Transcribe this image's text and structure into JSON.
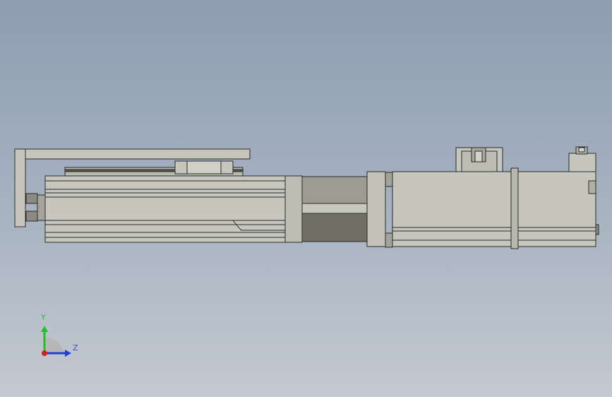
{
  "viewport": {
    "background_top": "#8e9db1",
    "background_bottom": "#c3c9d1",
    "part_fill": "#c6c6bc",
    "part_dark": "#6f6f66",
    "edge_color": "#2b2b2b"
  },
  "triad": {
    "y_label": "Y",
    "z_label": "Z",
    "y_color": "#22c022",
    "z_color": "#1f3fd8",
    "x_color": "#d81f1f"
  }
}
